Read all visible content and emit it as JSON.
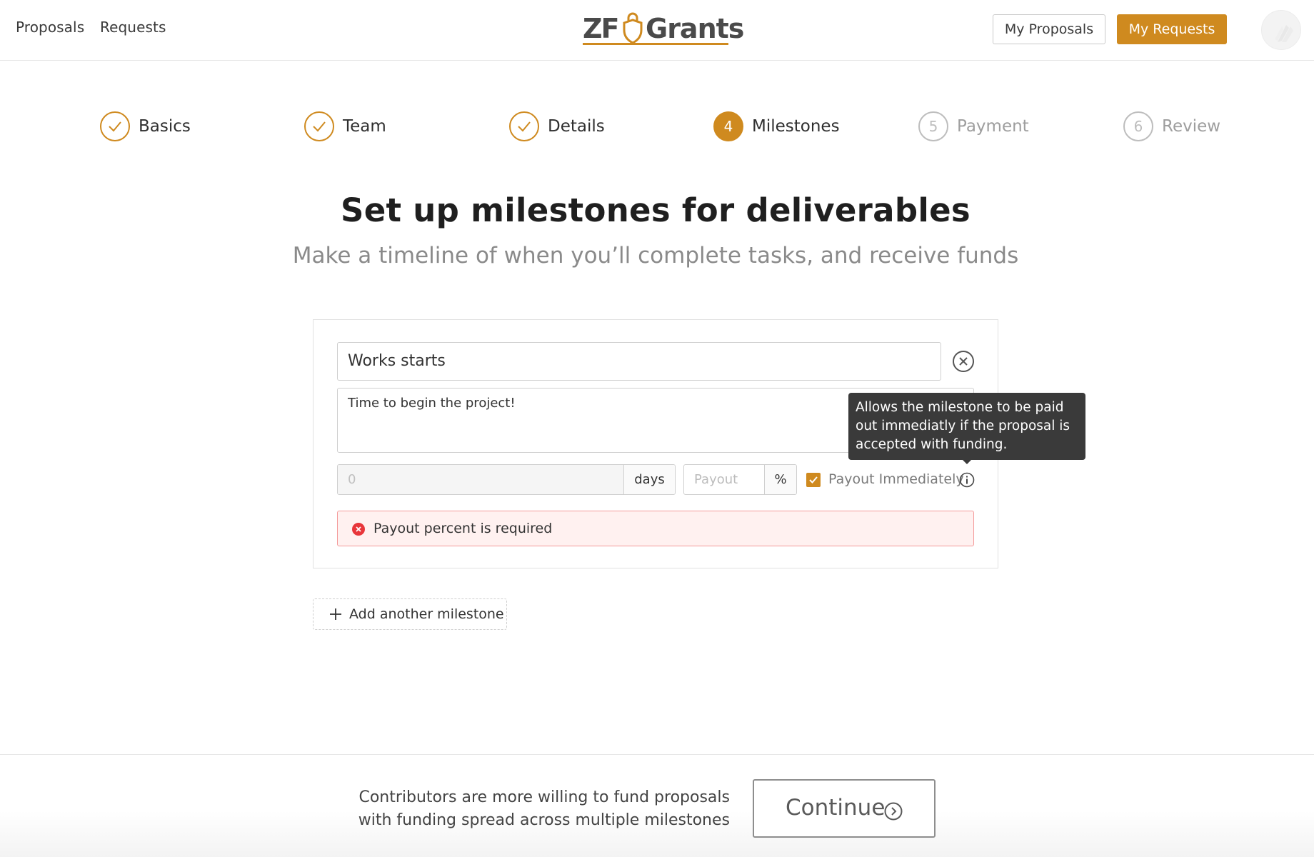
{
  "header": {
    "nav": [
      "Proposals",
      "Requests"
    ],
    "logo": {
      "left": "ZF",
      "right": "Grants"
    },
    "my_proposals": "My Proposals",
    "my_requests": "My Requests"
  },
  "steps": [
    {
      "label": "Basics",
      "state": "done",
      "marker": "✓"
    },
    {
      "label": "Team",
      "state": "done",
      "marker": "✓"
    },
    {
      "label": "Details",
      "state": "done",
      "marker": "✓"
    },
    {
      "label": "Milestones",
      "state": "active",
      "marker": "4"
    },
    {
      "label": "Payment",
      "state": "todo",
      "marker": "5"
    },
    {
      "label": "Review",
      "state": "todo",
      "marker": "6"
    }
  ],
  "page": {
    "title": "Set up milestones for deliverables",
    "subtitle": "Make a timeline of when you’ll complete tasks, and receive funds"
  },
  "milestone": {
    "title_value": "Works starts",
    "description_value": "Time to begin the project!",
    "days_placeholder": "0",
    "days_unit": "days",
    "payout_placeholder": "Payout",
    "payout_unit": "%",
    "payout_immediately_label": "Payout Immediately",
    "payout_immediately_checked": true,
    "error": "Payout percent is required"
  },
  "tooltip": {
    "text": "Allows the milestone to be paid out immediatly if the proposal is accepted with funding."
  },
  "add_milestone": "Add another milestone",
  "footer": {
    "note_line1": "Contributors are more willing to fund proposals",
    "note_line2": "with funding spread across multiple milestones",
    "continue": "Continue"
  },
  "colors": {
    "accent": "#cf8a1f",
    "error_border": "#f49a9a",
    "error_bg": "#fff1f0",
    "tooltip_bg": "#3a3a3a"
  }
}
